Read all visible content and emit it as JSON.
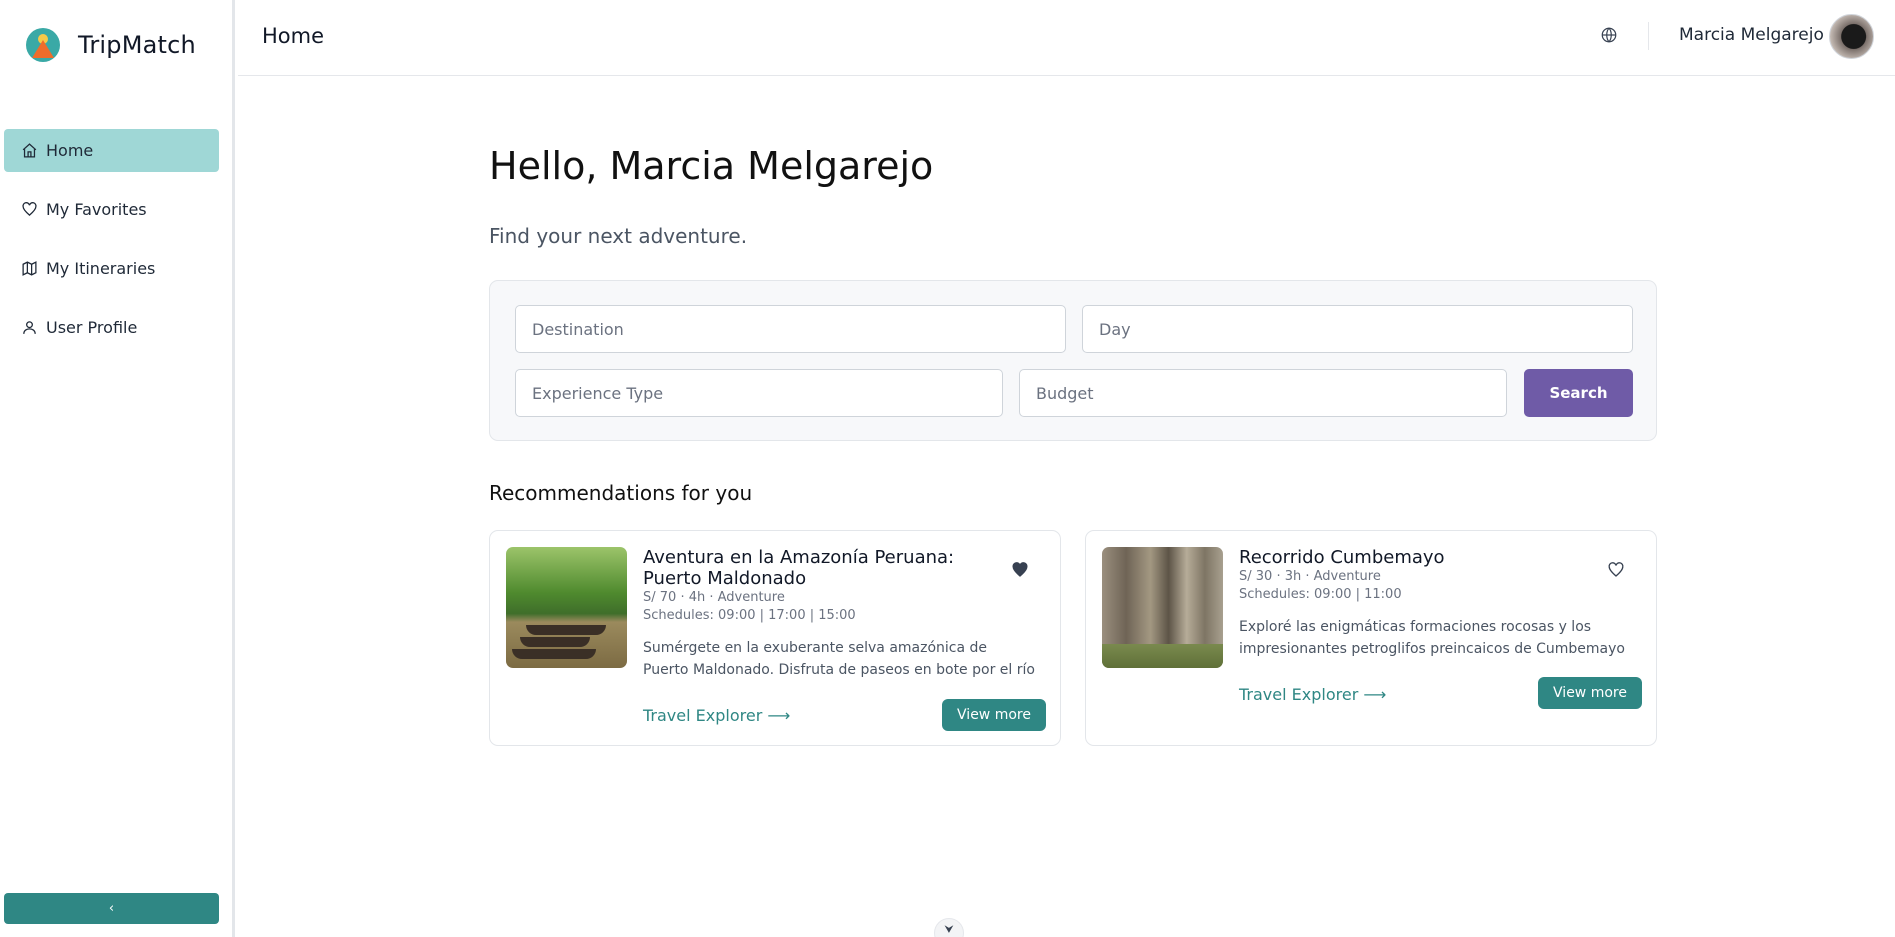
{
  "app": {
    "name": "TripMatch",
    "logo": "tripmatch-logo"
  },
  "sidebar": {
    "items": [
      {
        "label": "Home",
        "icon": "home-icon",
        "active": true
      },
      {
        "label": "My Favorites",
        "icon": "heart-icon",
        "active": false
      },
      {
        "label": "My Itineraries",
        "icon": "map-icon",
        "active": false
      },
      {
        "label": "User Profile",
        "icon": "user-icon",
        "active": false
      }
    ],
    "collapse_label": "‹"
  },
  "header": {
    "title": "Home",
    "language_icon": "globe-icon",
    "user_name": "Marcia Melgarejo"
  },
  "main": {
    "greeting": "Hello, Marcia Melgarejo",
    "subtitle": "Find your next adventure.",
    "search": {
      "destination_placeholder": "Destination",
      "day_placeholder": "Day",
      "experience_placeholder": "Experience Type",
      "budget_placeholder": "Budget",
      "button_label": "Search"
    },
    "recommendations_title": "Recommendations for you",
    "cards": [
      {
        "title": "Aventura en la Amazonía Peruana: Puerto Maldonado",
        "meta": "S/ 70 · 4h · Adventure",
        "schedules": "Schedules: 09:00 | 17:00 | 15:00",
        "desc_line1": "Sumérgete en la exuberante selva amazónica de",
        "desc_line2": "Puerto Maldonado. Disfruta de paseos en bote por el río",
        "favorite": true,
        "link_label": "Travel Explorer ⟶",
        "button_label": "View more"
      },
      {
        "title": "Recorrido Cumbemayo",
        "meta": "S/ 30 · 3h · Adventure",
        "schedules": "Schedules: 09:00 | 11:00",
        "desc_line1": "Exploré las enigmáticas formaciones rocosas y los",
        "desc_line2": "impresionantes petroglifos preincaicos de Cumbemayo",
        "favorite": false,
        "link_label": "Travel Explorer ⟶",
        "button_label": "View more"
      }
    ]
  },
  "colors": {
    "primary": "#2f8784",
    "active_nav": "#9fd7d6",
    "search_button": "#6f5ba7"
  },
  "scroll_hint": "⮟"
}
